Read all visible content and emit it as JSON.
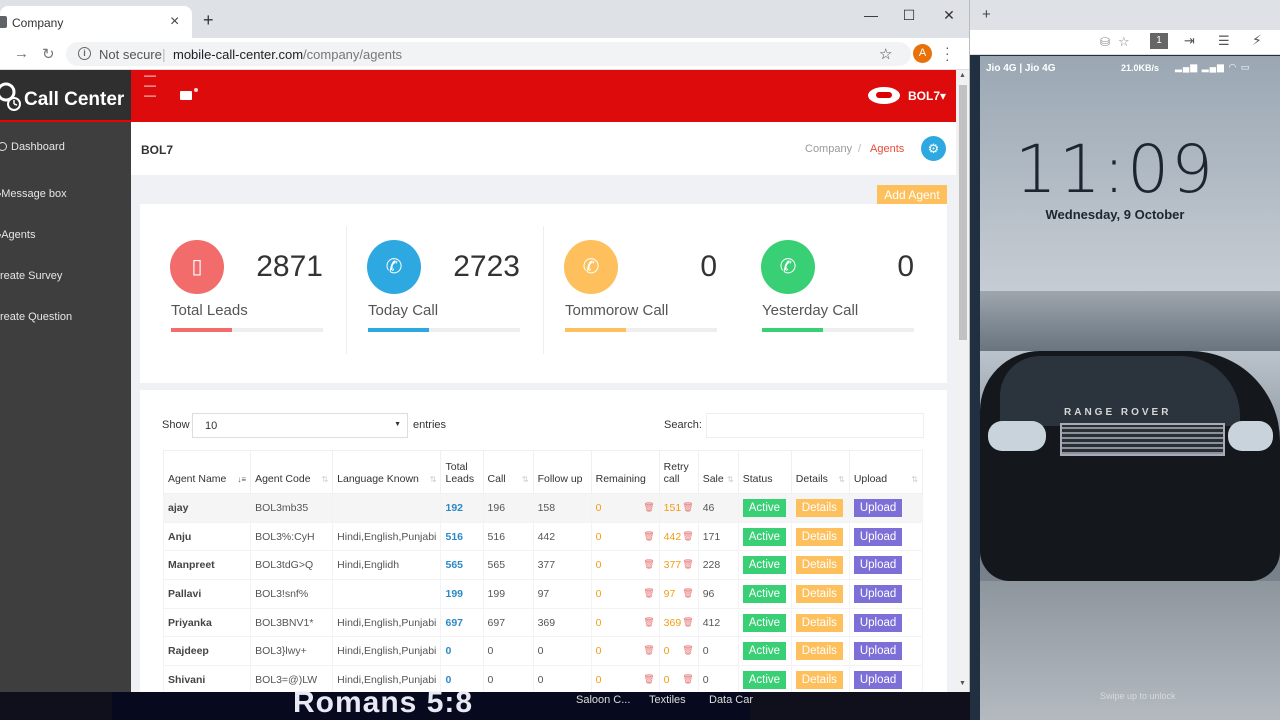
{
  "browser": {
    "tab_title": "Company",
    "tab_close": "×",
    "new_tab": "+",
    "minimize": "—",
    "maximize": "☐",
    "close": "✕",
    "security_label": "Not secure",
    "url_host": "mobile-call-center.com",
    "url_path": "/company/agents",
    "profile_initial": "A"
  },
  "sidebar": {
    "brand": "Call Center",
    "items": [
      {
        "label": "Dashboard"
      },
      {
        "label": "Message box"
      },
      {
        "label": "Agents"
      },
      {
        "label": "reate Survey"
      },
      {
        "label": "reate Question"
      }
    ]
  },
  "topnav": {
    "user": "BOL7▾"
  },
  "header": {
    "title": "BOL7",
    "breadcrumb": [
      "Company",
      "/",
      "Agents"
    ]
  },
  "add_agent_label": "Add Agent",
  "stats": [
    {
      "value": "2871",
      "label": "Total Leads",
      "color": "#f26c6c",
      "icon": "clipboard-icon",
      "fill": 0.4
    },
    {
      "value": "2723",
      "label": "Today Call",
      "color": "#2ea8e0",
      "icon": "phone-icon",
      "fill": 0.4
    },
    {
      "value": "0",
      "label": "Tommorow Call",
      "color": "#fdc05c",
      "icon": "phone-icon",
      "fill": 0.4
    },
    {
      "value": "0",
      "label": "Yesterday Call",
      "color": "#39d075",
      "icon": "phone-icon",
      "fill": 0.4
    }
  ],
  "table": {
    "show_label": "Show",
    "page_size": "10",
    "entries_label": "entries",
    "search_label": "Search:",
    "columns": [
      "Agent Name",
      "Agent Code",
      "Language Known",
      "Total Leads",
      "Call",
      "Follow up",
      "Remaining",
      "Retry call",
      "Sale",
      "Status",
      "Details",
      "Upload"
    ],
    "rows": [
      {
        "name": "ajay",
        "code": "BOL3mb35",
        "lang": "",
        "total": "192",
        "call": "196",
        "follow": "158",
        "remaining": "0",
        "retry": "151",
        "sale": "46"
      },
      {
        "name": "Anju",
        "code": "BOL3%:CyH",
        "lang": "Hindi,English,Punjabi",
        "total": "516",
        "call": "516",
        "follow": "442",
        "remaining": "0",
        "retry": "442",
        "sale": "171"
      },
      {
        "name": "Manpreet",
        "code": "BOL3tdG>Q",
        "lang": "Hindi,Englidh",
        "total": "565",
        "call": "565",
        "follow": "377",
        "remaining": "0",
        "retry": "377",
        "sale": "228"
      },
      {
        "name": "Pallavi",
        "code": "BOL3!snf%",
        "lang": "",
        "total": "199",
        "call": "199",
        "follow": "97",
        "remaining": "0",
        "retry": "97",
        "sale": "96"
      },
      {
        "name": "Priyanka",
        "code": "BOL3BNV1*",
        "lang": "Hindi,English,Punjabi",
        "total": "697",
        "call": "697",
        "follow": "369",
        "remaining": "0",
        "retry": "369",
        "sale": "412"
      },
      {
        "name": "Rajdeep",
        "code": "BOL3}lwy+",
        "lang": "Hindi,English,Punjabi",
        "total": "0",
        "call": "0",
        "follow": "0",
        "remaining": "0",
        "retry": "0",
        "sale": "0"
      },
      {
        "name": "Shivani",
        "code": "BOL3=@)LW",
        "lang": "Hindi,English,Punjabi",
        "total": "0",
        "call": "0",
        "follow": "0",
        "remaining": "0",
        "retry": "0",
        "sale": "0"
      }
    ],
    "status_label": "Active",
    "details_label": "Details",
    "upload_label": "Upload"
  },
  "phone": {
    "carrier": "Jio 4G | Jio 4G",
    "status_right": "21.0KB/s",
    "time": "11:09",
    "date": "Wednesday, 9 October",
    "car_brand": "RANGE ROVER",
    "swipe_hint": "Swipe up to unlock"
  },
  "taskbar": {
    "verse": "Romans 5:8",
    "items": [
      "Saloon C...",
      "Textiles",
      "Data Car"
    ]
  }
}
